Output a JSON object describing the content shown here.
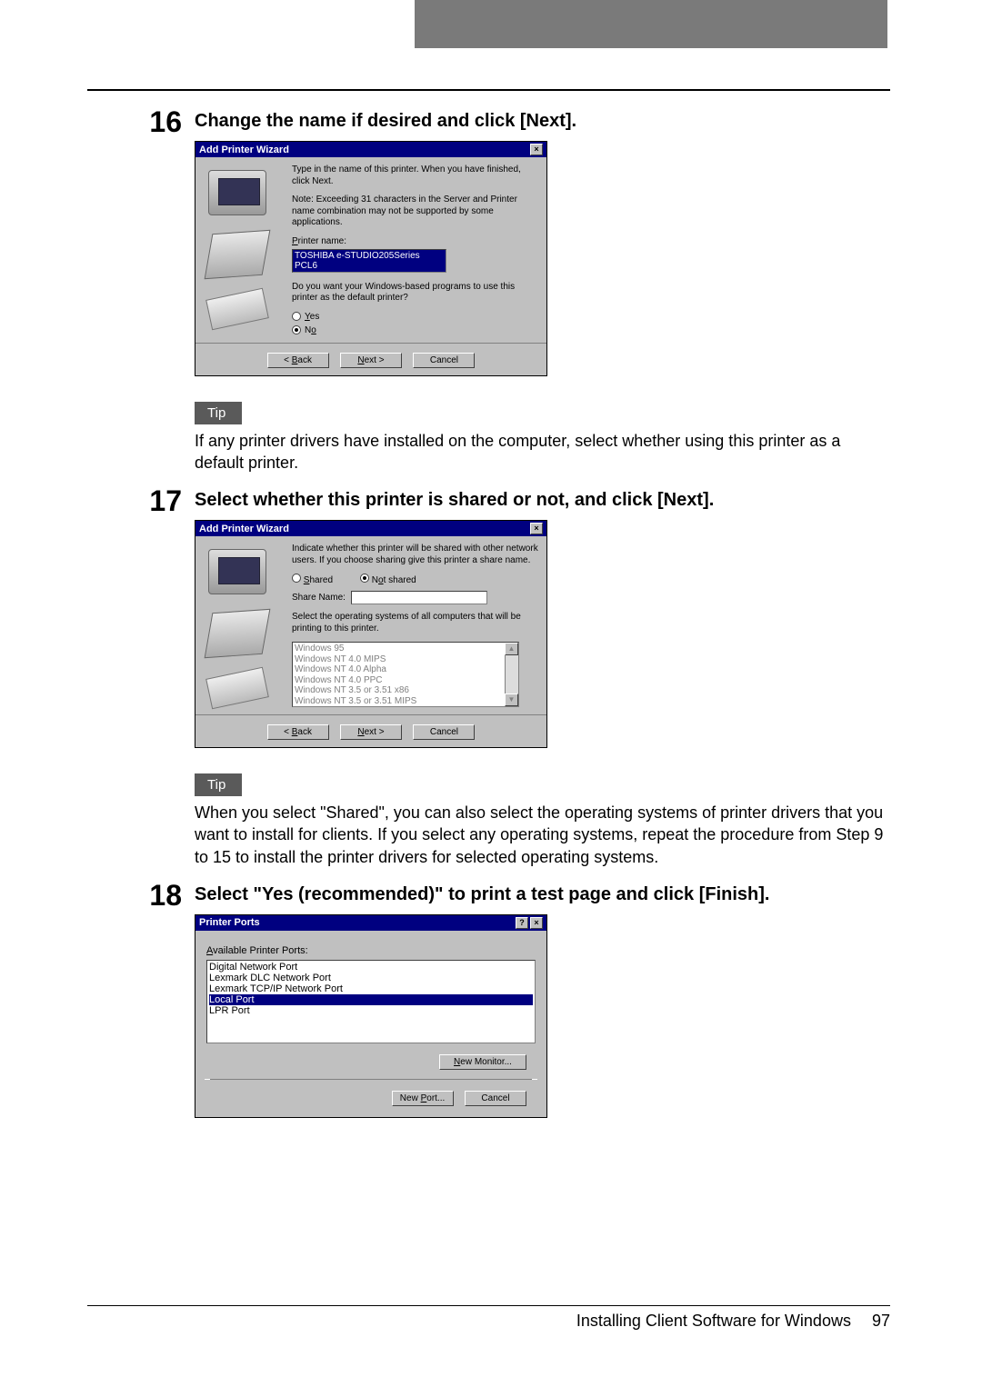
{
  "steps": {
    "s16": {
      "num": "16",
      "heading": "Change the name if desired and click [Next].",
      "dialog": {
        "title": "Add Printer Wizard",
        "intro": "Type in the name of this printer.  When you have finished, click Next.",
        "note": "Note:  Exceeding 31 characters in the Server and Printer name combination may not be supported by some applications.",
        "printer_name_label": "Printer name:",
        "printer_name_value": "TOSHIBA e-STUDIO205Series PCL6",
        "default_q": "Do you want your Windows-based programs to use this printer as the default printer?",
        "yes": "Yes",
        "no": "No",
        "back": "< Back",
        "next": "Next >",
        "cancel": "Cancel"
      },
      "tip_label": "Tip",
      "tip_text": "If any printer drivers have installed on the computer, select whether using this printer as a default printer."
    },
    "s17": {
      "num": "17",
      "heading": "Select whether this printer is shared or not, and click [Next].",
      "dialog": {
        "title": "Add Printer Wizard",
        "intro": "Indicate whether this printer will be shared with other network users.  If you choose sharing give this printer a share name.",
        "shared": "Shared",
        "not_shared": "Not shared",
        "share_name_label": "Share Name:",
        "os_intro": "Select the operating systems of all computers that will be printing to this printer.",
        "os_items": [
          "Windows 95",
          "Windows NT 4.0 MIPS",
          "Windows NT 4.0 Alpha",
          "Windows NT 4.0 PPC",
          "Windows NT 3.5 or 3.51 x86",
          "Windows NT 3.5 or 3.51 MIPS"
        ],
        "back": "< Back",
        "next": "Next >",
        "cancel": "Cancel"
      },
      "tip_label": "Tip",
      "tip_text": "When you select \"Shared\", you can also select the operating systems of printer drivers that you want to install for clients. If you select any operating systems, repeat the procedure from Step 9 to 15 to install the printer drivers for selected operating systems."
    },
    "s18": {
      "num": "18",
      "heading": "Select \"Yes (recommended)\" to print a test page and click [Finish].",
      "dialog": {
        "title": "Printer Ports",
        "available_label": "Available Printer Ports:",
        "ports": [
          "Digital Network Port",
          "Lexmark DLC Network Port",
          "Lexmark TCP/IP Network Port",
          "Local Port",
          "LPR Port"
        ],
        "selected_port_index": 3,
        "new_monitor": "New Monitor...",
        "new_port": "New Port...",
        "cancel": "Cancel"
      }
    }
  },
  "footer": {
    "text": "Installing Client Software for Windows",
    "page": "97"
  }
}
